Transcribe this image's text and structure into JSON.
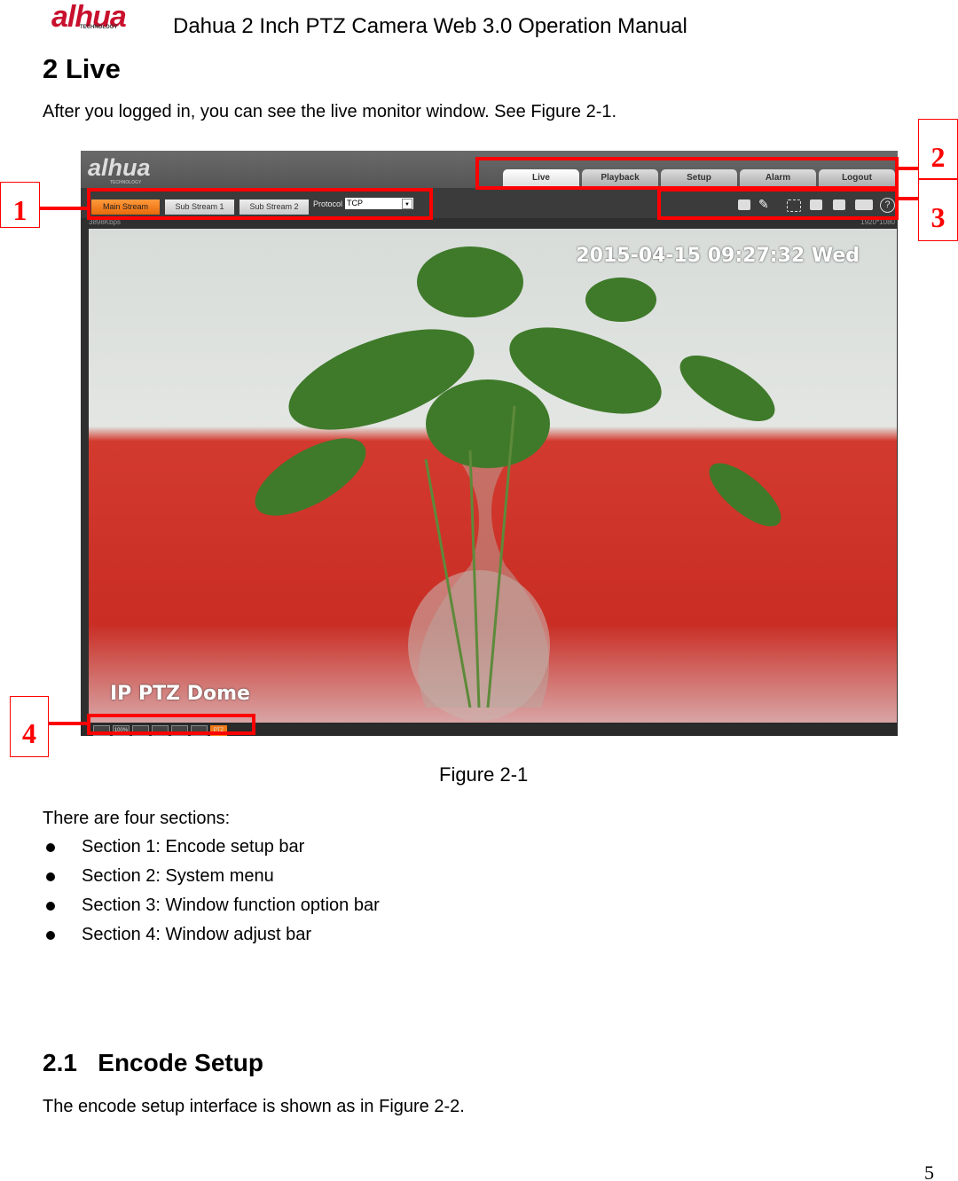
{
  "header": {
    "logo": "alhua",
    "logo_sub": "TECHNOLOGY",
    "title": "Dahua 2 Inch PTZ Camera Web 3.0 Operation Manual"
  },
  "section": {
    "title": "2  Live",
    "intro": "After you logged in, you can see the live monitor window. See Figure 2-1."
  },
  "figure": {
    "logo": "alhua",
    "logo_sub": "TECHNOLOGY",
    "menu": [
      {
        "label": "Live",
        "active": true
      },
      {
        "label": "Playback"
      },
      {
        "label": "Setup"
      },
      {
        "label": "Alarm"
      },
      {
        "label": "Logout"
      }
    ],
    "streams": [
      {
        "label": "Main Stream",
        "active": true
      },
      {
        "label": "Sub Stream 1"
      },
      {
        "label": "Sub Stream 2"
      }
    ],
    "protocol_label": "Protocol",
    "protocol_value": "TCP",
    "bitrate": "3898Kbps",
    "resolution": "1920*1080",
    "osd_time": "2015-04-15 09:27:32 Wed",
    "osd_name": "IP PTZ Dome",
    "bottom_buttons": [
      "",
      "100%",
      "",
      "",
      "",
      "",
      "PTZ"
    ],
    "callouts": [
      "1",
      "2",
      "3",
      "4"
    ],
    "caption": "Figure 2-1"
  },
  "sections_intro": "There are four sections:",
  "sections": [
    "Section 1: Encode setup bar",
    "Section 2: System menu",
    "Section 3: Window function option bar",
    "Section 4: Window adjust bar"
  ],
  "subsection": {
    "title": "2.1   Encode Setup",
    "text": "The encode setup interface is shown as in Figure 2-2."
  },
  "page_number": "5",
  "colors": {
    "callout": "#ff0000",
    "active_stream": "#f07a1a"
  }
}
